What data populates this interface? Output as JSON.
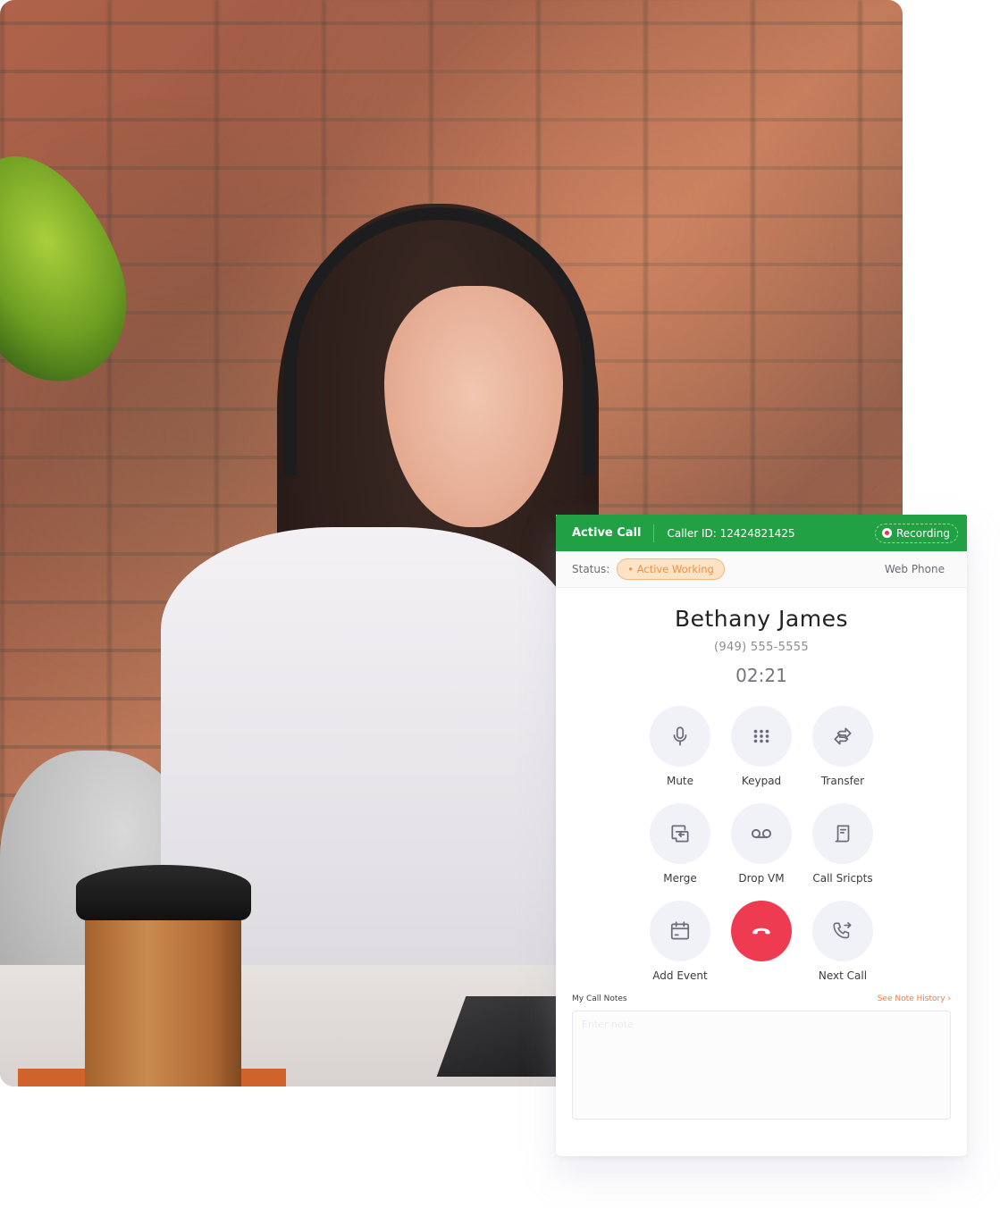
{
  "photo": {
    "description": "Smiling woman with headset at desk in front of brick wall"
  },
  "header": {
    "title": "Active Call",
    "caller_id": "Caller ID: 12424821425",
    "recording_label": "Recording"
  },
  "status": {
    "label": "Status:",
    "value": "• Active Working",
    "mode": "Web Phone"
  },
  "contact": {
    "name": "Bethany James",
    "phone": "(949) 555-5555",
    "timer": "02:21"
  },
  "actions": [
    {
      "label": "Mute",
      "icon": "microphone-icon"
    },
    {
      "label": "Keypad",
      "icon": "keypad-icon"
    },
    {
      "label": "Transfer",
      "icon": "transfer-icon"
    },
    {
      "label": "Merge",
      "icon": "merge-icon"
    },
    {
      "label": "Drop VM",
      "icon": "voicemail-icon"
    },
    {
      "label": "Call Sricpts",
      "icon": "script-icon"
    },
    {
      "label": "Add Event",
      "icon": "calendar-icon"
    },
    {
      "label": "",
      "icon": "hang-up-icon"
    },
    {
      "label": "Next Call",
      "icon": "next-call-icon"
    }
  ],
  "notes": {
    "title": "My Call Notes",
    "history_link": "See Note History ›",
    "placeholder": "Enter note"
  },
  "colors": {
    "header_green": "#21a044",
    "end_call_red": "#ee3b51",
    "status_orange": "#e6924f",
    "link_orange": "#ef7d4a"
  }
}
